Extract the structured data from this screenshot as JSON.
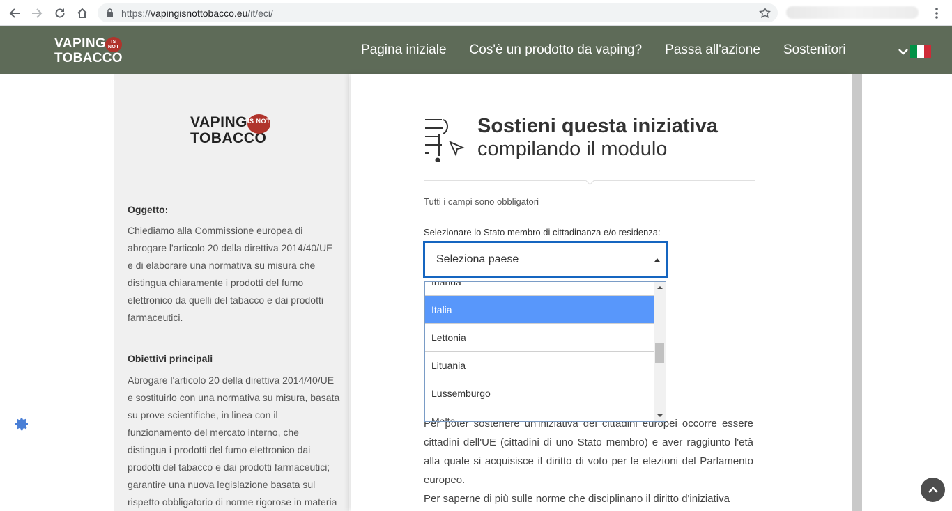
{
  "browser": {
    "url_prefix": "https://",
    "url_host": "vapingisnottobacco.eu",
    "url_path": "/it/eci/"
  },
  "header": {
    "logo_line1": "VAPING",
    "logo_line2": "TOBACCO",
    "logo_badge": "IS NOT",
    "nav": [
      "Pagina iniziale",
      "Cos'è un prodotto da vaping?",
      "Passa all'azione",
      "Sostenitori"
    ],
    "flag_colors": [
      "#009246",
      "#ffffff",
      "#ce2b37"
    ]
  },
  "sidebar": {
    "logo_line1": "VAPING",
    "logo_line2": "TOBACCO",
    "logo_badge": "IS NOT",
    "subject_heading": "Oggetto:",
    "subject_text": "Chiediamo alla Commissione europea di abrogare l'articolo 20 della direttiva 2014/40/UE e di elaborare una normativa su misura che distingua chiaramente i prodotti del fumo elettronico da quelli del tabacco e dai prodotti farmaceutici.",
    "goals_heading": "Obiettivi principali",
    "goals_text": "Abrogare l'articolo 20 della direttiva 2014/40/UE e sostituirlo con una normativa su misura, basata su prove scientifiche, in linea con il funzionamento del mercato interno, che distingua i prodotti del fumo elettronico dai prodotti del tabacco e dai prodotti farmaceutici; garantire una nuova legislazione basata sul rispetto obbligatorio di norme rigorose in materia"
  },
  "form": {
    "title_bold": "Sostieni questa iniziativa",
    "title_light": "compilando il modulo",
    "required_note": "Tutti i campi sono obbligatori",
    "country_label": "Selezionare lo Stato membro di cittadinanza e/o residenza:",
    "country_placeholder": "Seleziona paese",
    "options": [
      "Irlanda",
      "Italia",
      "Lettonia",
      "Lituania",
      "Lussemburgo",
      "Malta"
    ],
    "selected_option": "Italia",
    "body_text_1": "Per poter sostenere un'iniziativa dei cittadini europei occorre essere cittadini dell'UE (cittadini di uno Stato membro) e aver raggiunto l'età alla quale si acquisisce il diritto di voto per le elezioni del Parlamento europeo.",
    "body_text_2": "Per saperne di più sulle norme che disciplinano il diritto d'iniziativa"
  },
  "colors": {
    "header_bg": "#5e6b58",
    "select_border": "#1565c0",
    "option_highlight": "#5897fb",
    "badge_red": "#b0342c"
  }
}
